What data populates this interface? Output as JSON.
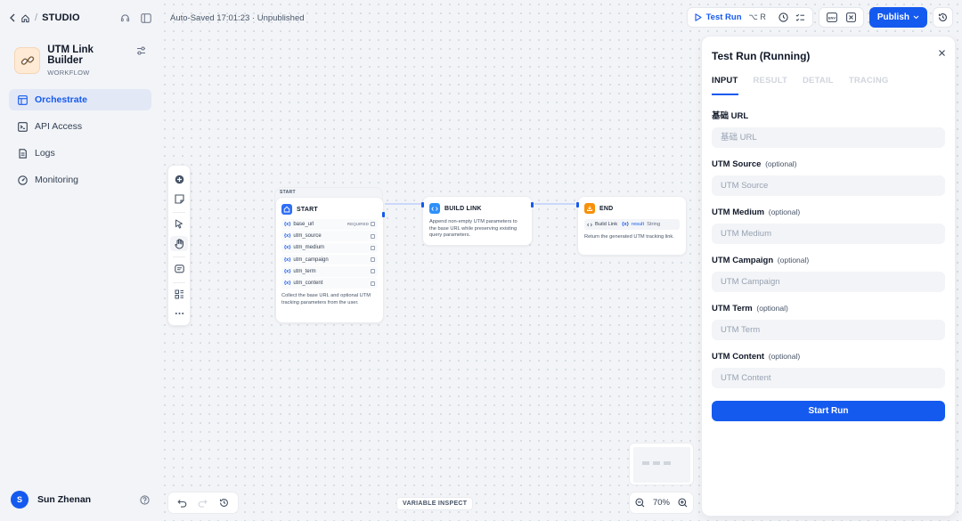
{
  "sidebar": {
    "studio_label": "STUDIO",
    "app": {
      "title": "UTM Link Builder",
      "type": "WORKFLOW"
    },
    "nav": [
      {
        "label": "Orchestrate",
        "icon": "layout-icon",
        "active": true
      },
      {
        "label": "API Access",
        "icon": "terminal-icon",
        "active": false
      },
      {
        "label": "Logs",
        "icon": "file-list-icon",
        "active": false
      },
      {
        "label": "Monitoring",
        "icon": "dashboard-icon",
        "active": false
      }
    ],
    "user": {
      "initial": "S",
      "name": "Sun Zhenan"
    }
  },
  "header": {
    "autosave": "Auto-Saved 17:01:23 · Unpublished",
    "test_run_label": "Test Run",
    "test_run_shortcut": "⌥ R",
    "env_label": "ENV",
    "publish_label": "Publish"
  },
  "nodes": {
    "start": {
      "group_label": "START",
      "title": "START",
      "variables": [
        {
          "name": "base_url",
          "required": "REQUIRED"
        },
        {
          "name": "utm_source",
          "required": ""
        },
        {
          "name": "utm_medium",
          "required": ""
        },
        {
          "name": "utm_campaign",
          "required": ""
        },
        {
          "name": "utm_term",
          "required": ""
        },
        {
          "name": "utm_content",
          "required": ""
        }
      ],
      "var_prefix": "{x}",
      "description": "Collect the base URL and optional UTM tracking parameters from the user."
    },
    "build": {
      "title": "BUILD LINK",
      "description": "Append non-empty UTM parameters to the base URL while preserving existing query parameters."
    },
    "end": {
      "title": "END",
      "output_source": "Build Link",
      "output_var": "result",
      "output_type": "String",
      "description": "Return the generated UTM tracking link."
    }
  },
  "panel": {
    "title": "Test Run (Running)",
    "tabs": [
      "INPUT",
      "RESULT",
      "DETAIL",
      "TRACING"
    ],
    "active_tab": "INPUT",
    "fields": [
      {
        "label": "基础 URL",
        "optional": "",
        "placeholder": "基础 URL"
      },
      {
        "label": "UTM Source",
        "optional": "(optional)",
        "placeholder": "UTM Source"
      },
      {
        "label": "UTM Medium",
        "optional": "(optional)",
        "placeholder": "UTM Medium"
      },
      {
        "label": "UTM Campaign",
        "optional": "(optional)",
        "placeholder": "UTM Campaign"
      },
      {
        "label": "UTM Term",
        "optional": "(optional)",
        "placeholder": "UTM Term"
      },
      {
        "label": "UTM Content",
        "optional": "(optional)",
        "placeholder": "UTM Content"
      }
    ],
    "start_run_label": "Start Run"
  },
  "canvas": {
    "variable_inspect_label": "VARIABLE INSPECT",
    "zoom_level": "70%"
  },
  "colors": {
    "accent": "#155aef",
    "start_badge": "#2e6ef7",
    "build_badge": "#2e90fa",
    "end_badge": "#f79009"
  }
}
